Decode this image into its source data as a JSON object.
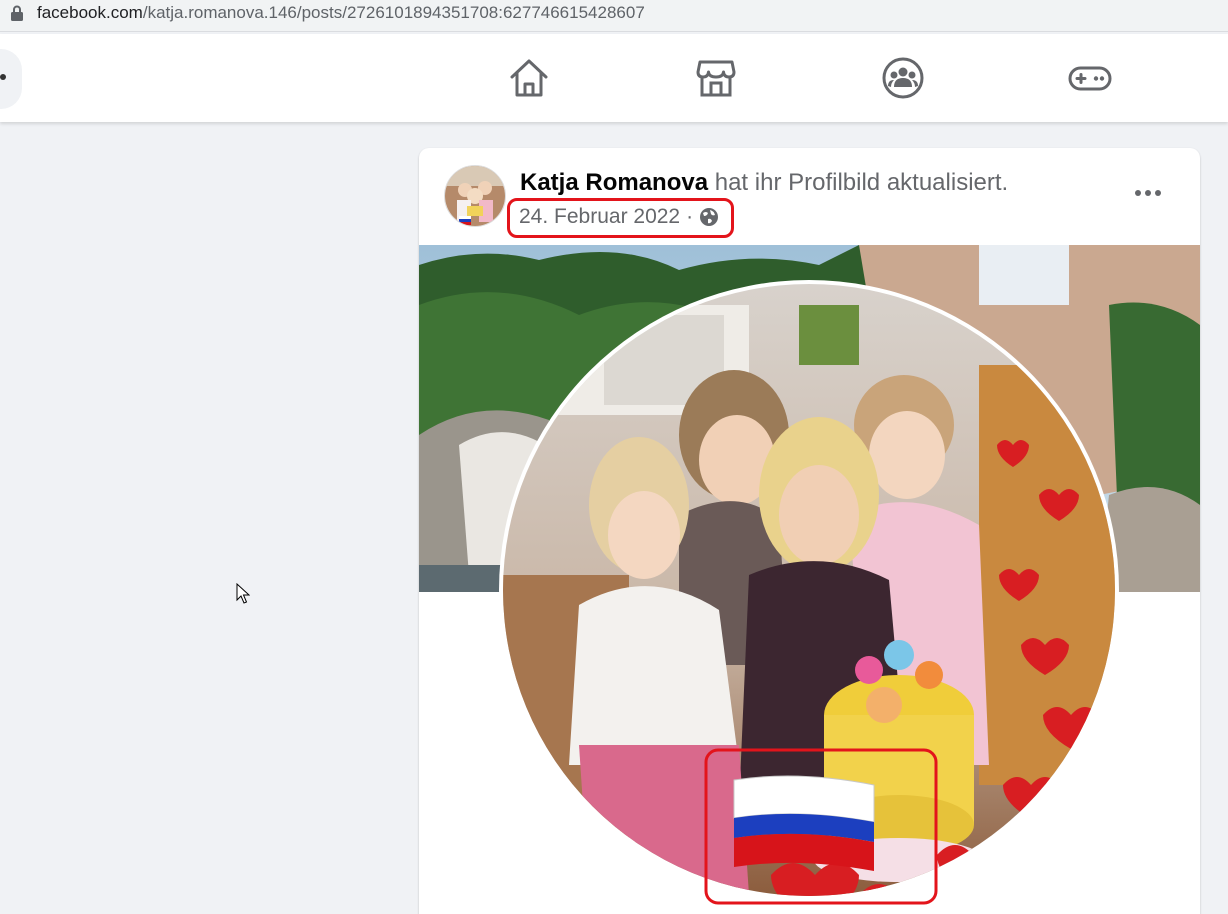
{
  "browser": {
    "url_domain": "facebook.com",
    "url_path": "/katja.romanova.146/posts/2726101894351708:627746615428607"
  },
  "nav": {
    "icons": [
      "home-icon",
      "marketplace-icon",
      "groups-icon",
      "gaming-icon"
    ]
  },
  "post": {
    "author": "Katja Romanova",
    "action": "hat ihr Profilbild aktualisiert.",
    "date": "24. Februar 2022",
    "separator": "·",
    "privacy_icon": "globe-icon",
    "menu_icon": "more-options-icon"
  },
  "colors": {
    "highlight": "#e3141b",
    "facebook_bg": "#f0f2f5"
  }
}
